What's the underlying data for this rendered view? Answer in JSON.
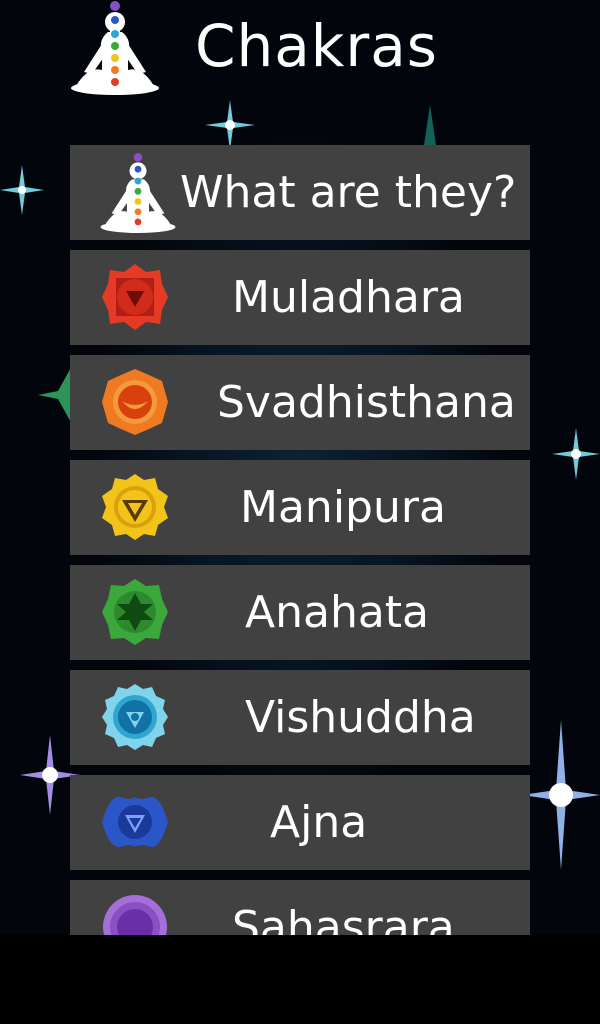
{
  "header": {
    "title": "Chakras",
    "logo_icon": "meditating-figure-icon"
  },
  "menu": {
    "items": [
      {
        "label": "What are they?",
        "icon": "meditating-figure-icon"
      },
      {
        "label": "Muladhara",
        "icon": "root-chakra-icon",
        "color": "#e53a26"
      },
      {
        "label": "Svadhisthana",
        "icon": "sacral-chakra-icon",
        "color": "#f07a22"
      },
      {
        "label": "Manipura",
        "icon": "solar-plexus-chakra-icon",
        "color": "#f2c41a"
      },
      {
        "label": "Anahata",
        "icon": "heart-chakra-icon",
        "color": "#3aa83a"
      },
      {
        "label": "Vishuddha",
        "icon": "throat-chakra-icon",
        "color": "#2fa6cf"
      },
      {
        "label": "Ajna",
        "icon": "third-eye-chakra-icon",
        "color": "#2a56c8"
      },
      {
        "label": "Sahasrara",
        "icon": "crown-chakra-icon",
        "color": "#8a4fc3"
      }
    ]
  }
}
